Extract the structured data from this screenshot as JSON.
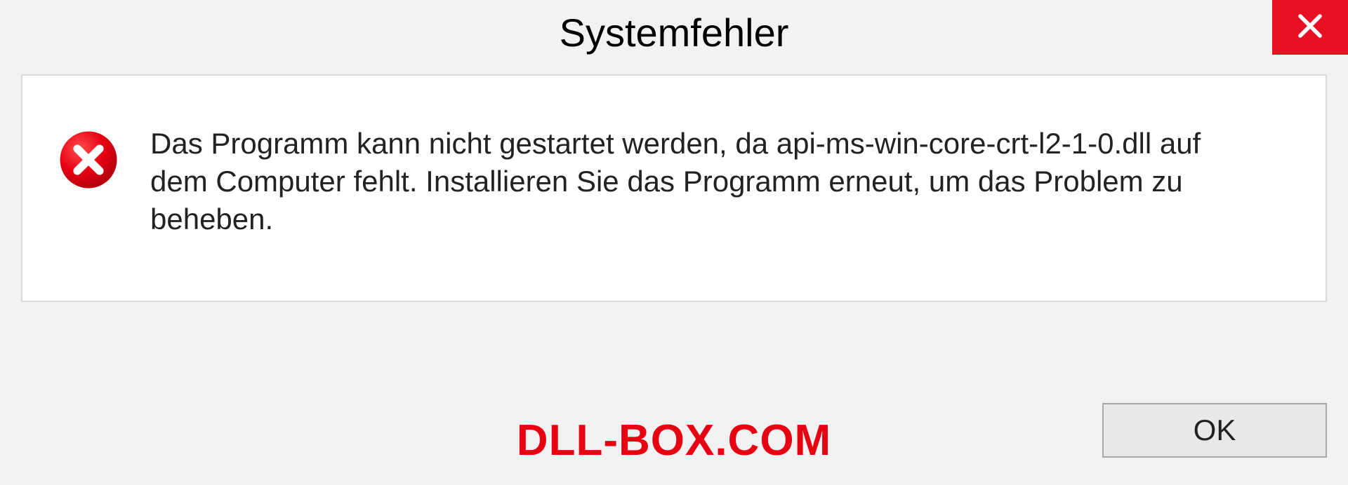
{
  "dialog": {
    "title": "Systemfehler",
    "message": "Das Programm kann nicht gestartet werden, da api-ms-win-core-crt-l2-1-0.dll auf dem Computer fehlt. Installieren Sie das Programm erneut, um das Problem zu beheben.",
    "ok_label": "OK"
  },
  "watermark": "DLL-BOX.COM",
  "colors": {
    "close_bg": "#e81123",
    "error_icon": "#e60012",
    "watermark": "#e60012"
  }
}
